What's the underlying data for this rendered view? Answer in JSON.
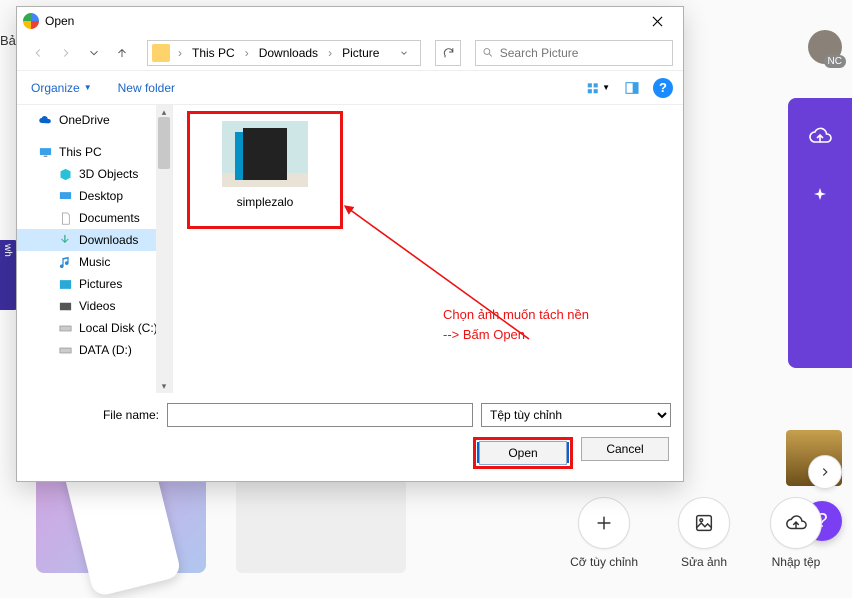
{
  "bg": {
    "top_left_text": "Bả",
    "avatar_badge": "NC",
    "actions": [
      {
        "label": "Cỡ tùy chỉnh"
      },
      {
        "label": "Sửa ảnh"
      },
      {
        "label": "Nhập tệp"
      }
    ],
    "help": "?",
    "left_edge": "wh"
  },
  "dialog": {
    "title": "Open",
    "breadcrumb": {
      "root": "This PC",
      "p1": "Downloads",
      "p2": "Picture"
    },
    "search_placeholder": "Search Picture",
    "toolbar": {
      "organize": "Organize",
      "new_folder": "New folder"
    },
    "tree": {
      "onedrive": "OneDrive",
      "thispc": "This PC",
      "objects3d": "3D Objects",
      "desktop": "Desktop",
      "documents": "Documents",
      "downloads": "Downloads",
      "music": "Music",
      "pictures": "Pictures",
      "videos": "Videos",
      "localdisk": "Local Disk (C:)",
      "data": "DATA (D:)"
    },
    "file": {
      "name": "simplezalo"
    },
    "annotation": {
      "line1": "Chọn ảnh muốn tách nền",
      "line2": "--> Bấm Open"
    },
    "footer": {
      "filename_label": "File name:",
      "filename_value": "",
      "filter": "Tệp tùy chỉnh",
      "open": "Open",
      "cancel": "Cancel"
    }
  }
}
